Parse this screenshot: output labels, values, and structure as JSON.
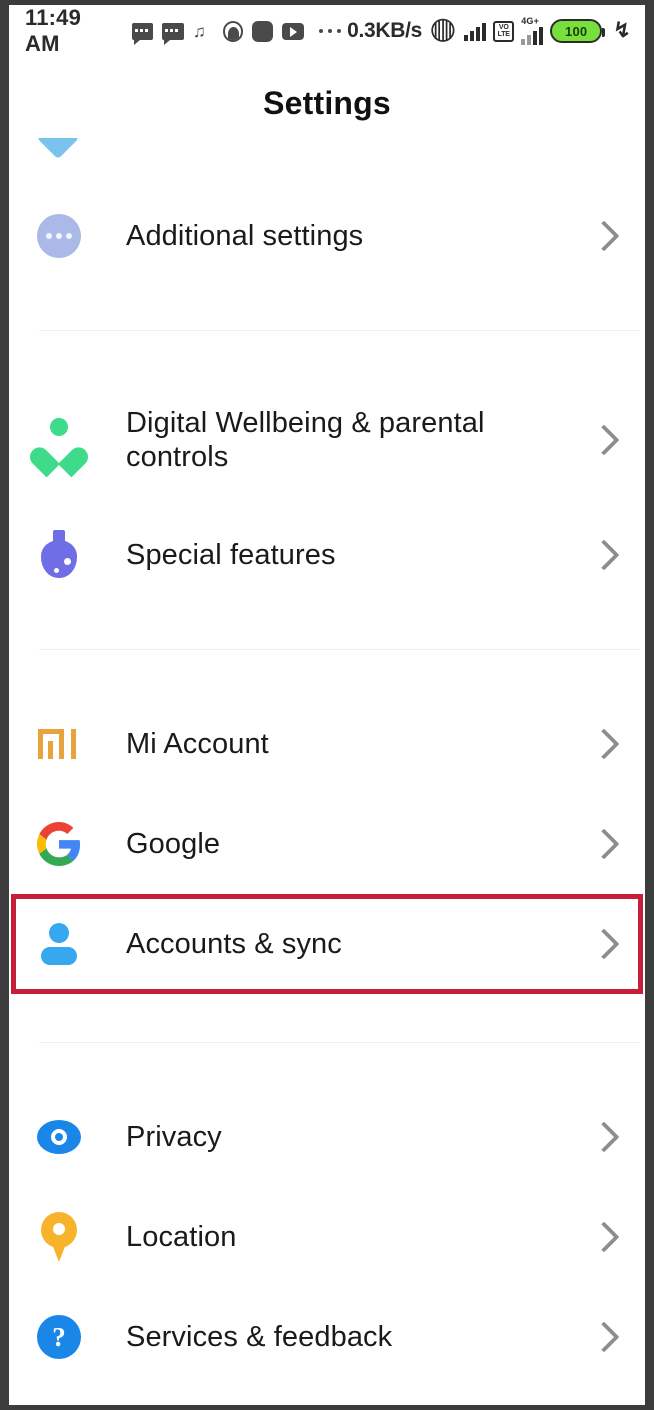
{
  "status_bar": {
    "time": "11:49 AM",
    "icons_left": [
      "message-bubble-icon",
      "message-bubble-icon",
      "music-app-icon",
      "avatar-app-icon",
      "square-app-icon",
      "video-app-icon"
    ],
    "overflow": "ellipsis-icon",
    "network_speed": "0.3KB/s",
    "bluetooth": "bluetooth-icon",
    "signal_one": "signal-bars-icon",
    "volte": {
      "line1": "VO",
      "line2": "LTE"
    },
    "network_type": "4G+",
    "signal_two": "signal-bars-icon",
    "battery_level": "100",
    "charging": "charging-bolt-icon"
  },
  "header": {
    "title": "Settings"
  },
  "list": {
    "clipped_top_row": {
      "label": "",
      "icon": "partial-row-icon"
    },
    "groups": [
      {
        "items": [
          {
            "label": "Additional settings",
            "icon": "three-dots-circle-icon",
            "chevron": "chevron-right-icon"
          }
        ]
      },
      {
        "items": [
          {
            "label": "Digital Wellbeing & parental controls",
            "icon": "wellbeing-heart-icon",
            "chevron": "chevron-right-icon"
          },
          {
            "label": "Special features",
            "icon": "flask-icon",
            "chevron": "chevron-right-icon"
          }
        ]
      },
      {
        "items": [
          {
            "label": "Mi Account",
            "icon": "mi-logo-icon",
            "chevron": "chevron-right-icon"
          },
          {
            "label": "Google",
            "icon": "google-g-icon",
            "chevron": "chevron-right-icon"
          },
          {
            "label": "Accounts & sync",
            "icon": "person-icon",
            "chevron": "chevron-right-icon",
            "highlighted": true
          }
        ]
      },
      {
        "items": [
          {
            "label": "Privacy",
            "icon": "eye-icon",
            "chevron": "chevron-right-icon"
          },
          {
            "label": "Location",
            "icon": "location-pin-icon",
            "chevron": "chevron-right-icon"
          },
          {
            "label": "Services & feedback",
            "icon": "question-mark-circle-icon",
            "chevron": "chevron-right-icon"
          }
        ]
      }
    ]
  },
  "colors": {
    "highlight_border": "#c62039",
    "additional_settings_icon": "#aab9e8",
    "wellbeing_icon": "#3ddb8a",
    "flask_icon": "#6f6ee6",
    "mi_icon": "#e8a33d",
    "person_icon": "#37a8f0",
    "eye_icon": "#1a87e8",
    "location_icon": "#f7b32b",
    "help_icon": "#1a87e8",
    "battery_fill": "#78e03c",
    "divider": "#eceff1",
    "text": "#1a1a1a"
  }
}
